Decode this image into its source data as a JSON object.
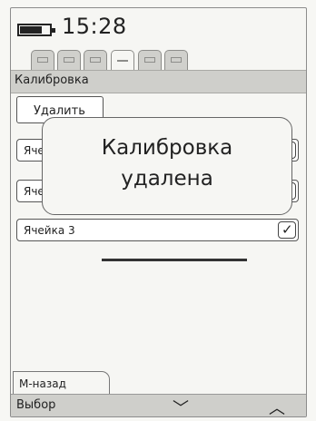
{
  "status": {
    "time": "15:28",
    "battery_icon": "battery-icon"
  },
  "tabs": [
    {
      "icon": "tab-1-icon"
    },
    {
      "icon": "tab-2-icon"
    },
    {
      "icon": "tab-3-icon"
    },
    {
      "icon": "tab-4-icon",
      "active": true
    },
    {
      "icon": "tab-5-icon"
    },
    {
      "icon": "tab-6-icon"
    }
  ],
  "screen": {
    "title": "Калибровка",
    "delete_button": "Удалить"
  },
  "cells": [
    {
      "label": "Ячейка 1",
      "checked": false
    },
    {
      "label": "Ячейка 2",
      "checked": false
    },
    {
      "label": "Ячейка 3",
      "checked": true
    }
  ],
  "popup": {
    "line1": "Калибровка",
    "line2": "удалена"
  },
  "softkeys": {
    "back": "М-назад",
    "select": "Выбор",
    "down_icon": "chevron-down-icon",
    "up_icon": "chevron-up-icon"
  }
}
